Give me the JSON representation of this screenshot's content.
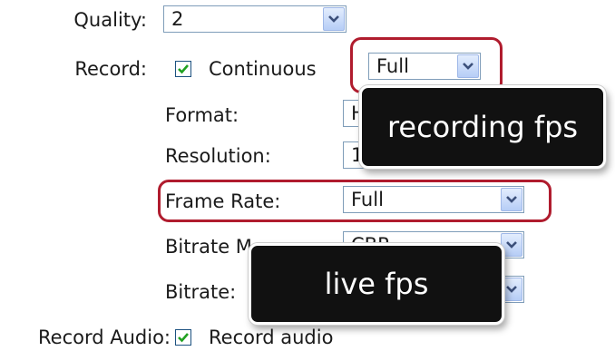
{
  "form": {
    "quality": {
      "label": "Quality:",
      "value": "2"
    },
    "record": {
      "label": "Record:",
      "checkbox_label": "Continuous",
      "checked": true,
      "value": "Full"
    },
    "format": {
      "label": "Format:",
      "value": "H"
    },
    "resolution": {
      "label": "Resolution:",
      "value": "1"
    },
    "frame_rate": {
      "label": "Frame Rate:",
      "value": "Full"
    },
    "bitrate_mode": {
      "label": "Bitrate Mo",
      "value": "CBR"
    },
    "bitrate": {
      "label": "Bitrate:",
      "value": ""
    },
    "record_audio": {
      "label": "Record Audio:",
      "checkbox_label": "Record audio",
      "checked": true
    }
  },
  "annotations": {
    "recording_callout": "recording fps",
    "live_callout": "live fps",
    "highlight_color": "#b01c2e"
  },
  "icons": {
    "dropdown": "chevron-down-icon",
    "checkbox": "check-icon"
  }
}
